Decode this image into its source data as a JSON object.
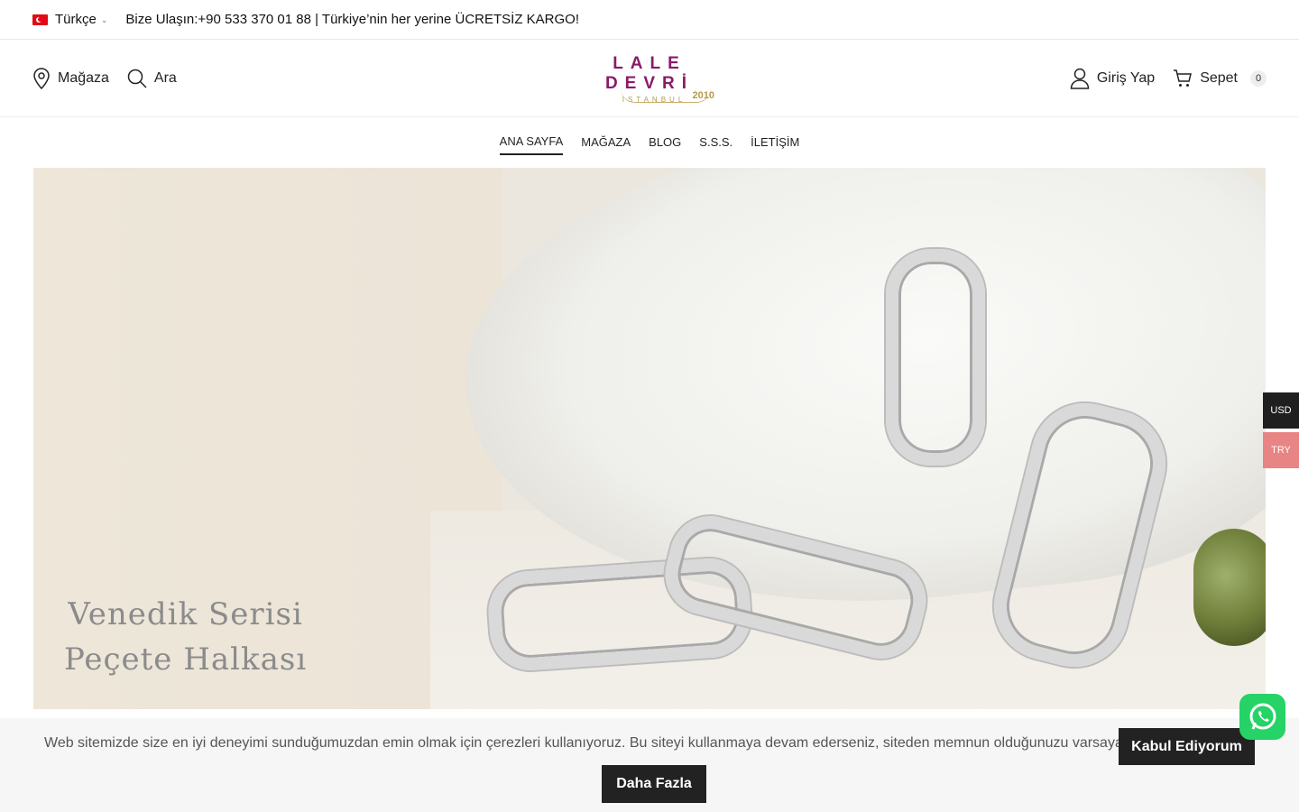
{
  "topbar": {
    "language": "Türkçe",
    "contact": "Bize Ulaşın:+90 533 370 01 88  | Türkiye’nin her yerine ÜCRETSİZ KARGO!"
  },
  "header": {
    "store_label": "Mağaza",
    "search_label": "Ara",
    "login_label": "Giriş Yap",
    "cart_label": "Sepet",
    "cart_count": "0",
    "logo": {
      "main": "LALE DEVRİ",
      "sub": "İSTANBUL",
      "year": "2010"
    }
  },
  "nav": {
    "items": [
      {
        "label": "ANA SAYFA"
      },
      {
        "label": "MAĞAZA"
      },
      {
        "label": "BLOG"
      },
      {
        "label": "S.S.S."
      },
      {
        "label": "İLETİŞİM"
      }
    ]
  },
  "hero": {
    "title_line1": "Venedik Serisi",
    "title_line2": "Peçete Halkası"
  },
  "currency": {
    "usd": "USD",
    "try": "TRY"
  },
  "cookie": {
    "text": "Web sitemizde size en iyi deneyimi sunduğumuzdan emin olmak için çerezleri kullanıyoruz. Bu siteyi kullanmaya devam ederseniz, siteden memnun olduğunuzu varsayacağız.",
    "accept_label": "Kabul Ediyorum",
    "more_label": "Daha Fazla"
  },
  "colors": {
    "brand": "#8a1a6b",
    "gold": "#b39b4c",
    "whatsapp": "#25d366",
    "usd_bg": "#1f1f1f",
    "try_bg": "#e98484"
  },
  "icons": {
    "store": "map-pin-icon",
    "search": "search-icon",
    "login": "user-icon",
    "cart": "cart-icon",
    "whatsapp": "whatsapp-icon"
  }
}
